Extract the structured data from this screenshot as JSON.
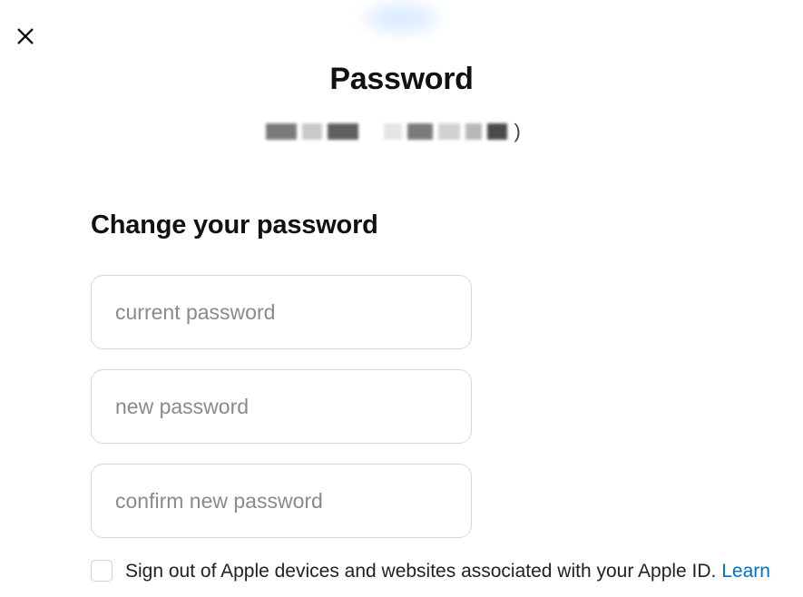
{
  "header": {
    "title": "Password",
    "account_trailing_char": ")"
  },
  "form": {
    "heading": "Change your password",
    "current_placeholder": "current password",
    "new_placeholder": "new password",
    "confirm_placeholder": "confirm new password"
  },
  "signout": {
    "label": "Sign out of Apple devices and websites associated with your Apple ID. ",
    "learn_more": "Learn"
  }
}
